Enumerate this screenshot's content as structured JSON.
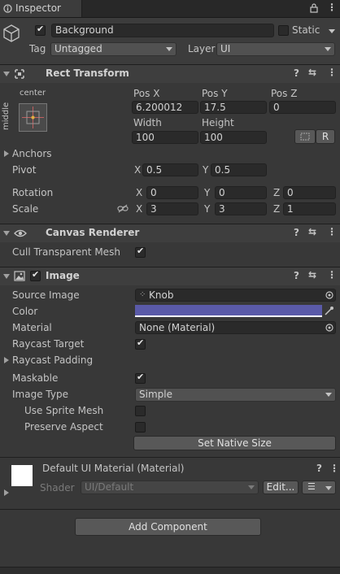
{
  "tab": {
    "title": "Inspector"
  },
  "gameobject": {
    "name": "Background",
    "static_label": "Static",
    "tag_label": "Tag",
    "tag_value": "Untagged",
    "layer_label": "Layer",
    "layer_value": "UI"
  },
  "rect_transform": {
    "title": "Rect Transform",
    "anchor_h": "center",
    "anchor_v": "middle",
    "pos_x_label": "Pos X",
    "pos_y_label": "Pos Y",
    "pos_z_label": "Pos Z",
    "pos_x": "6.200012",
    "pos_y": "17.5",
    "pos_z": "0",
    "width_label": "Width",
    "height_label": "Height",
    "width": "100",
    "height": "100",
    "r_button": "R",
    "anchors_label": "Anchors",
    "pivot_label": "Pivot",
    "pivot_x_label": "X",
    "pivot_x": "0.5",
    "pivot_y_label": "Y",
    "pivot_y": "0.5",
    "rotation_label": "Rotation",
    "rot_x_label": "X",
    "rot_x": "0",
    "rot_y_label": "Y",
    "rot_y": "0",
    "rot_z_label": "Z",
    "rot_z": "0",
    "scale_label": "Scale",
    "scale_x_label": "X",
    "scale_x": "3",
    "scale_y_label": "Y",
    "scale_y": "3",
    "scale_z_label": "Z",
    "scale_z": "1"
  },
  "canvas_renderer": {
    "title": "Canvas Renderer",
    "cull_label": "Cull Transparent Mesh"
  },
  "image": {
    "title": "Image",
    "source_label": "Source Image",
    "source_value": "Knob",
    "color_label": "Color",
    "color_value": "#5a5aa8",
    "material_label": "Material",
    "material_value": "None (Material)",
    "raycast_target_label": "Raycast Target",
    "raycast_padding_label": "Raycast Padding",
    "maskable_label": "Maskable",
    "image_type_label": "Image Type",
    "image_type_value": "Simple",
    "use_sprite_mesh_label": "Use Sprite Mesh",
    "preserve_aspect_label": "Preserve Aspect",
    "set_native_size": "Set Native Size"
  },
  "material_preview": {
    "title": "Default UI Material (Material)",
    "shader_label": "Shader",
    "shader_value": "UI/Default",
    "edit_button": "Edit..."
  },
  "add_component": "Add Component"
}
